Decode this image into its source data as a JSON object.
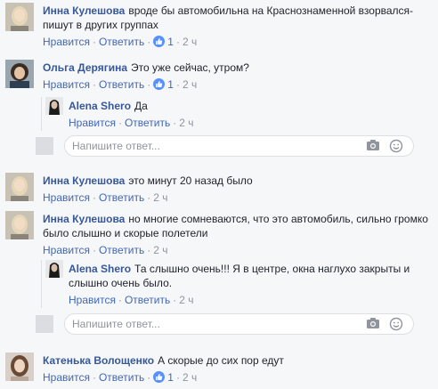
{
  "labels": {
    "like": "Нравится",
    "reply": "Ответить",
    "dot": "·",
    "reply_placeholder": "Напишите ответ..."
  },
  "comments": [
    {
      "author": "Инна Кулешова",
      "text": "вроде бы автомобильна на Краснознаменной взорвался- пишут в других группах",
      "likes": "1",
      "time": "2 ч"
    },
    {
      "author": "Ольга Дерягина",
      "text": "Это уже сейчас, утром?",
      "likes": "1",
      "time": "2 ч",
      "reply": {
        "author": "Alena Shero",
        "text": "Да",
        "time": "2 ч"
      }
    },
    {
      "author": "Инна Кулешова",
      "text": "это минут 20 назад было",
      "time": "2 ч"
    },
    {
      "author": "Инна Кулешова",
      "text": "но многие сомневаются, что это автомобиль, сильно громко было слышно и скорые полетели",
      "time": "2 ч",
      "reply": {
        "author": "Alena Shero",
        "text": "Та слышно очень!!! Я в центре, окна наглухо закрыты и слышно очень было.",
        "time": "2 ч"
      }
    },
    {
      "author": "Катенька Волощенко",
      "text": "А скорые до сих пор едут",
      "likes": "1",
      "time": "2 ч"
    }
  ],
  "colors": {
    "name": "#365899",
    "link": "#4267b2",
    "meta": "#90949c",
    "like_badge": "#5890ff",
    "background": "#f6f7f9"
  }
}
